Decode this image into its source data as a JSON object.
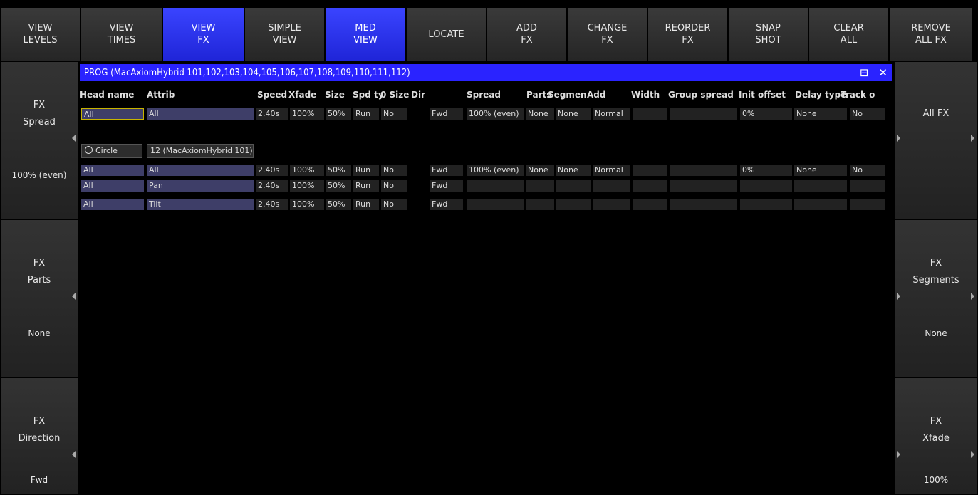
{
  "toolbar": [
    {
      "l1": "VIEW",
      "l2": "LEVELS",
      "active": false
    },
    {
      "l1": "VIEW",
      "l2": "TIMES",
      "active": false
    },
    {
      "l1": "VIEW",
      "l2": "FX",
      "active": true
    },
    {
      "l1": "SIMPLE",
      "l2": "VIEW",
      "active": false
    },
    {
      "l1": "MED",
      "l2": "VIEW",
      "active": true
    },
    {
      "l1": "LOCATE",
      "l2": "",
      "active": false
    },
    {
      "l1": "ADD",
      "l2": "FX",
      "active": false
    },
    {
      "l1": "CHANGE",
      "l2": "FX",
      "active": false
    },
    {
      "l1": "REORDER",
      "l2": "FX",
      "active": false
    },
    {
      "l1": "SNAP",
      "l2": "SHOT",
      "active": false
    },
    {
      "l1": "CLEAR",
      "l2": "ALL",
      "active": false
    },
    {
      "l1": "REMOVE",
      "l2": "ALL FX",
      "active": false
    }
  ],
  "left_panel": [
    {
      "l1": "FX",
      "l2": "Spread",
      "value": "100% (even)"
    },
    {
      "l1": "FX",
      "l2": "Parts",
      "value": "None"
    },
    {
      "l1": "FX",
      "l2": "Direction",
      "value": "Fwd"
    }
  ],
  "right_panel": [
    {
      "l1": "All FX",
      "l2": "",
      "value": ""
    },
    {
      "l1": "FX",
      "l2": "Segments",
      "value": "None"
    },
    {
      "l1": "FX",
      "l2": "Xfade",
      "value": "100%"
    }
  ],
  "window": {
    "title": "PROG (MacAxiomHybrid 101,102,103,104,105,106,107,108,109,110,111,112)",
    "minimize_glyph": "⊟",
    "close_glyph": "✕"
  },
  "columns": [
    "Head name",
    "Attrib",
    "Speed",
    "Xfade",
    "Size",
    "Spd ty",
    "0 Size",
    "Dir",
    "Spread",
    "Parts",
    "Segmen",
    "Add",
    "Width",
    "Group spread",
    "Init offset",
    "Delay type",
    "Track o"
  ],
  "rows": {
    "top": [
      "All",
      "All",
      "2.40s",
      "100%",
      "50%",
      "Run",
      "No",
      "Fwd",
      "100% (even)",
      "None",
      "None",
      "Normal",
      "",
      "",
      "0%",
      "None",
      "No"
    ],
    "circle_button": "Circle",
    "circle_label": "12 (MacAxiomHybrid 101)",
    "group": [
      [
        "All",
        "All",
        "2.40s",
        "100%",
        "50%",
        "Run",
        "No",
        "Fwd",
        "100% (even)",
        "None",
        "None",
        "Normal",
        "",
        "",
        "0%",
        "None",
        "No"
      ],
      [
        "All",
        "Pan",
        "2.40s",
        "100%",
        "50%",
        "Run",
        "No",
        "Fwd",
        "",
        "",
        "",
        "",
        "",
        "",
        "",
        "",
        ""
      ],
      [
        "All",
        "Tilt",
        "2.40s",
        "100%",
        "50%",
        "Run",
        "No",
        "Fwd",
        "",
        "",
        "",
        "",
        "",
        "",
        "",
        "",
        ""
      ]
    ]
  },
  "colors": {
    "accent": "#2a23ff",
    "button_active": "#2a30f0",
    "cell_lavender": "#3e3e68",
    "cell_dark": "#222222",
    "selection": "#c8b400"
  }
}
